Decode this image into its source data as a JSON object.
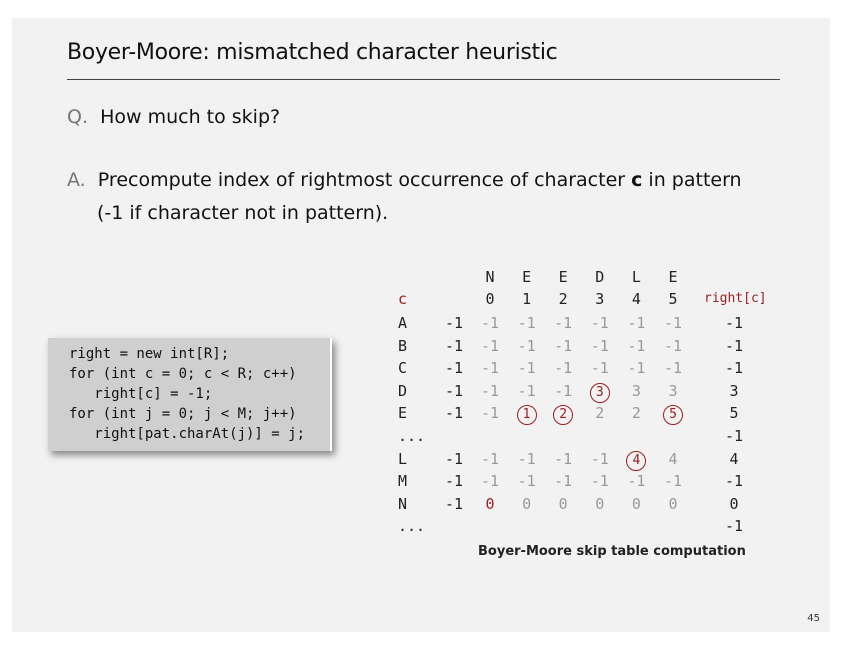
{
  "slide": {
    "title": "Boyer-Moore:  mismatched character heuristic",
    "q_label": "Q.",
    "q_text": "How much to skip?",
    "a_label": "A.",
    "a_text_pre": "Precompute index of rightmost occurrence of character ",
    "a_char": "c",
    "a_text_post": " in pattern",
    "a_text_line2": "(-1 if character not in pattern).",
    "page_number": "45"
  },
  "code": [
    "right = new int[R];",
    "for (int c = 0; c < R; c++)",
    "   right[c] = -1;",
    "for (int j = 0; j < M; j++)",
    "   right[pat.charAt(j)] = j;"
  ],
  "table": {
    "c_header": "c",
    "right_header": "right[c]",
    "pattern_chars": [
      "N",
      "E",
      "E",
      "D",
      "L",
      "E"
    ],
    "indices": [
      "0",
      "1",
      "2",
      "3",
      "4",
      "5"
    ],
    "rows": [
      {
        "c": "A",
        "init": "-1",
        "steps": [
          {
            "v": "-1",
            "s": "gray"
          },
          {
            "v": "-1",
            "s": "gray"
          },
          {
            "v": "-1",
            "s": "gray"
          },
          {
            "v": "-1",
            "s": "gray"
          },
          {
            "v": "-1",
            "s": "gray"
          },
          {
            "v": "-1",
            "s": "gray"
          }
        ],
        "right": "-1"
      },
      {
        "c": "B",
        "init": "-1",
        "steps": [
          {
            "v": "-1",
            "s": "gray"
          },
          {
            "v": "-1",
            "s": "gray"
          },
          {
            "v": "-1",
            "s": "gray"
          },
          {
            "v": "-1",
            "s": "gray"
          },
          {
            "v": "-1",
            "s": "gray"
          },
          {
            "v": "-1",
            "s": "gray"
          }
        ],
        "right": "-1"
      },
      {
        "c": "C",
        "init": "-1",
        "steps": [
          {
            "v": "-1",
            "s": "gray"
          },
          {
            "v": "-1",
            "s": "gray"
          },
          {
            "v": "-1",
            "s": "gray"
          },
          {
            "v": "-1",
            "s": "gray"
          },
          {
            "v": "-1",
            "s": "gray"
          },
          {
            "v": "-1",
            "s": "gray"
          }
        ],
        "right": "-1"
      },
      {
        "c": "D",
        "init": "-1",
        "steps": [
          {
            "v": "-1",
            "s": "gray"
          },
          {
            "v": "-1",
            "s": "gray"
          },
          {
            "v": "-1",
            "s": "gray"
          },
          {
            "v": "3",
            "s": "circle"
          },
          {
            "v": "3",
            "s": "gray"
          },
          {
            "v": "3",
            "s": "gray"
          }
        ],
        "right": "3"
      },
      {
        "c": "E",
        "init": "-1",
        "steps": [
          {
            "v": "-1",
            "s": "gray"
          },
          {
            "v": "1",
            "s": "circle"
          },
          {
            "v": "2",
            "s": "circle"
          },
          {
            "v": "2",
            "s": "gray"
          },
          {
            "v": "2",
            "s": "gray"
          },
          {
            "v": "5",
            "s": "circle"
          }
        ],
        "right": "5"
      },
      {
        "c": "...",
        "init": "",
        "steps": [],
        "right": "-1"
      },
      {
        "c": "L",
        "init": "-1",
        "steps": [
          {
            "v": "-1",
            "s": "gray"
          },
          {
            "v": "-1",
            "s": "gray"
          },
          {
            "v": "-1",
            "s": "gray"
          },
          {
            "v": "-1",
            "s": "gray"
          },
          {
            "v": "4",
            "s": "circle"
          },
          {
            "v": "4",
            "s": "gray"
          }
        ],
        "right": "4"
      },
      {
        "c": "M",
        "init": "-1",
        "steps": [
          {
            "v": "-1",
            "s": "gray"
          },
          {
            "v": "-1",
            "s": "gray"
          },
          {
            "v": "-1",
            "s": "gray"
          },
          {
            "v": "-1",
            "s": "gray"
          },
          {
            "v": "-1",
            "s": "gray"
          },
          {
            "v": "-1",
            "s": "gray"
          }
        ],
        "right": "-1"
      },
      {
        "c": "N",
        "init": "-1",
        "steps": [
          {
            "v": "0",
            "s": "red"
          },
          {
            "v": "0",
            "s": "gray"
          },
          {
            "v": "0",
            "s": "gray"
          },
          {
            "v": "0",
            "s": "gray"
          },
          {
            "v": "0",
            "s": "gray"
          },
          {
            "v": "0",
            "s": "gray"
          }
        ],
        "right": "0"
      },
      {
        "c": "...",
        "init": "",
        "steps": [],
        "right": "-1"
      }
    ],
    "caption": "Boyer-Moore skip table computation"
  },
  "colors": {
    "accent_red": "#9a1f1f",
    "gray_text": "#9a9a9a",
    "slide_bg": "#f2f2f2",
    "code_bg": "#cfcfcf"
  }
}
